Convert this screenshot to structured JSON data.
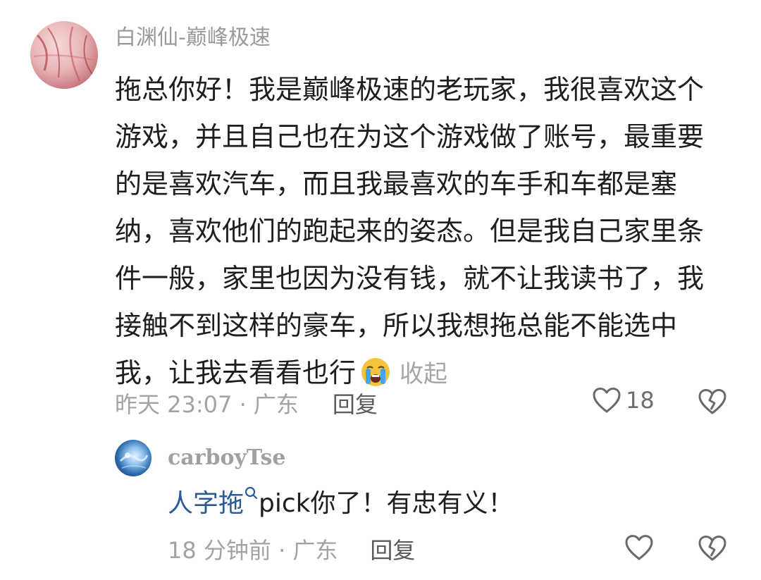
{
  "main_comment": {
    "username": "白渊仙-巅峰极速",
    "lines": [
      "拖总你好！我是巅峰极速的老玩家，我很喜欢这个",
      "游戏，并且自己也在为这个游戏做了账号，最重要",
      "的是喜欢汽车，而且我最喜欢的车手和车都是塞",
      "纳，喜欢他们的跑起来的姿态。但是我自己家里条",
      "件一般，家里也因为没有钱，就不让我读书了，我",
      "接触不到这样的豪车，所以我想拖总能不能选中",
      "我，让我去看看也行"
    ],
    "emoji": "loudly-crying-face-icon",
    "collapse_label": "收起",
    "timestamp_location": "昨天 23:07 · 广东",
    "reply_label": "回复",
    "like_count": "18"
  },
  "reply_comment": {
    "username": "carboyTse",
    "mention": "人字拖",
    "text": "pick你了！有忠有义！",
    "timestamp_location": "18 分钟前 · 广东",
    "reply_label": "回复"
  },
  "icons": {
    "like": "heart-outline-icon",
    "dislike": "broken-heart-icon",
    "mention_search": "search-icon"
  },
  "colors": {
    "mention": "#2c5b94",
    "secondary_text": "#a3a3a3",
    "primary_text": "#1e1e1e"
  }
}
